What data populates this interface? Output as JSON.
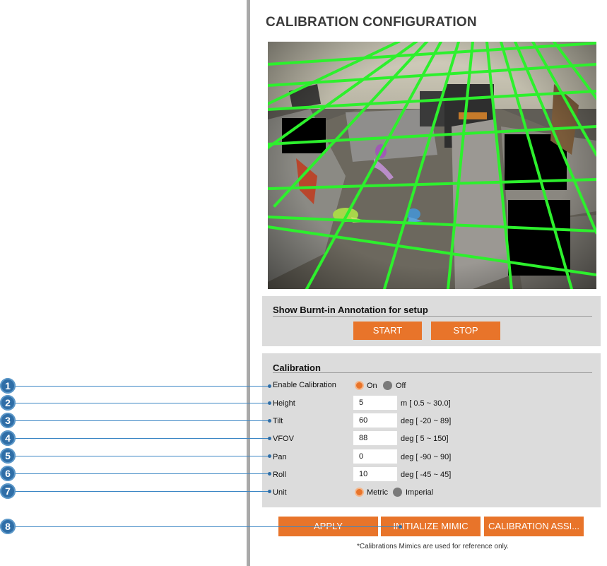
{
  "page": {
    "title": "CALIBRATION CONFIGURATION"
  },
  "burnin": {
    "heading": "Show Burnt-in Annotation for setup",
    "start_label": "START",
    "stop_label": "STOP"
  },
  "calibration": {
    "heading": "Calibration",
    "enable": {
      "label": "Enable Calibration",
      "on_label": "On",
      "off_label": "Off",
      "selected": "On"
    },
    "height": {
      "label": "Height",
      "value": "5",
      "range": "m [ 0.5 ~ 30.0]"
    },
    "tilt": {
      "label": "Tilt",
      "value": "60",
      "range": "deg [ -20 ~ 89]"
    },
    "vfov": {
      "label": "VFOV",
      "value": "88",
      "range": "deg [ 5 ~ 150]"
    },
    "pan": {
      "label": "Pan",
      "value": "0",
      "range": "deg [ -90 ~ 90]"
    },
    "roll": {
      "label": "Roll",
      "value": "10",
      "range": "deg [ -45 ~ 45]"
    },
    "unit": {
      "label": "Unit",
      "metric_label": "Metric",
      "imperial_label": "Imperial",
      "selected": "Metric"
    }
  },
  "actions": {
    "apply_label": "APPLY",
    "init_label": "INITIALIZE MIMIC",
    "assist_label": "CALIBRATION ASSI..."
  },
  "footnote": "*Calibrations Mimics are used for reference only.",
  "callouts": [
    "1",
    "2",
    "3",
    "4",
    "5",
    "6",
    "7",
    "8"
  ],
  "colors": {
    "accent": "#e8742a",
    "callout": "#2f6ea7",
    "grid": "#2df02d",
    "panel": "#dcdcdc"
  }
}
